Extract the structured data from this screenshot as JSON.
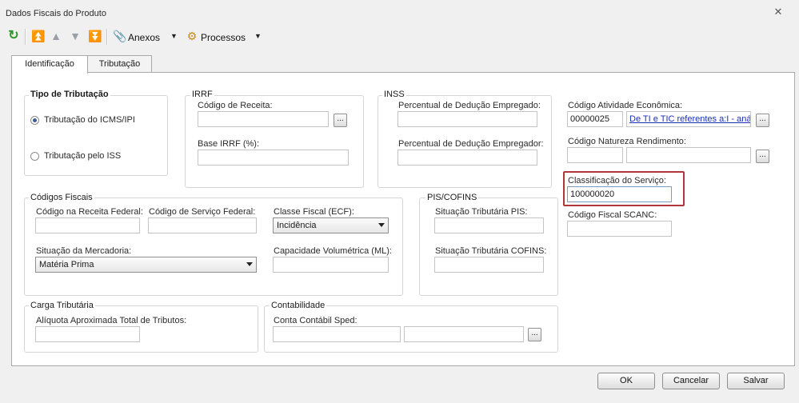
{
  "window": {
    "title": "Dados Fiscais do Produto"
  },
  "toolbar": {
    "anexos_label": "Anexos",
    "processos_label": "Processos"
  },
  "tabs": [
    {
      "label": "Identificação"
    },
    {
      "label": "Tributação"
    }
  ],
  "tipo_tributacao": {
    "legend": "Tipo de Tributação",
    "options": [
      {
        "label": "Tributação do ICMS/IPI",
        "checked": true
      },
      {
        "label": "Tributação pelo ISS",
        "checked": false
      }
    ]
  },
  "irrf": {
    "legend": "IRRF",
    "codigo_receita_label": "Código de Receita:",
    "codigo_receita_value": "",
    "base_label": "Base IRRF (%):",
    "base_value": ""
  },
  "inss": {
    "legend": "INSS",
    "empregado_label": "Percentual de Dedução Empregado:",
    "empregado_value": "",
    "empregador_label": "Percentual de Dedução Empregador:",
    "empregador_value": ""
  },
  "right": {
    "atividade_label": "Código Atividade Econômica:",
    "atividade_code": "00000025",
    "atividade_link": "De TI e TIC referentes a:I - anál",
    "natureza_label": "Código Natureza Rendimento:",
    "natureza_value": "",
    "classificacao_label": "Classificação do Serviço:",
    "classificacao_value": "100000020",
    "scanc_label": "Código Fiscal SCANC:",
    "scanc_value": ""
  },
  "codigos_fiscais": {
    "legend": "Códigos Fiscais",
    "receita_federal_label": "Código na Receita Federal:",
    "servico_federal_label": "Código de Serviço Federal:",
    "classe_fiscal_label": "Classe Fiscal (ECF):",
    "classe_fiscal_value": "Incidência",
    "situacao_label": "Situação da Mercadoria:",
    "situacao_value": "Matéria Prima",
    "capacidade_label": "Capacidade Volumétrica (ML):"
  },
  "pis_cofins": {
    "legend": "PIS/COFINS",
    "pis_label": "Situação Tributária PIS:",
    "cofins_label": "Situação Tributária COFINS:"
  },
  "carga": {
    "legend": "Carga Tributária",
    "aliquota_label": "Alíquota Aproximada Total de Tributos:"
  },
  "contabilidade": {
    "legend": "Contabilidade",
    "conta_label": "Conta Contábil Sped:"
  },
  "footer": {
    "ok_label": "OK",
    "cancel_label": "Cancelar",
    "save_label": "Salvar"
  },
  "colors": {
    "highlight": "#b0363a",
    "link": "#1a2fb8"
  }
}
